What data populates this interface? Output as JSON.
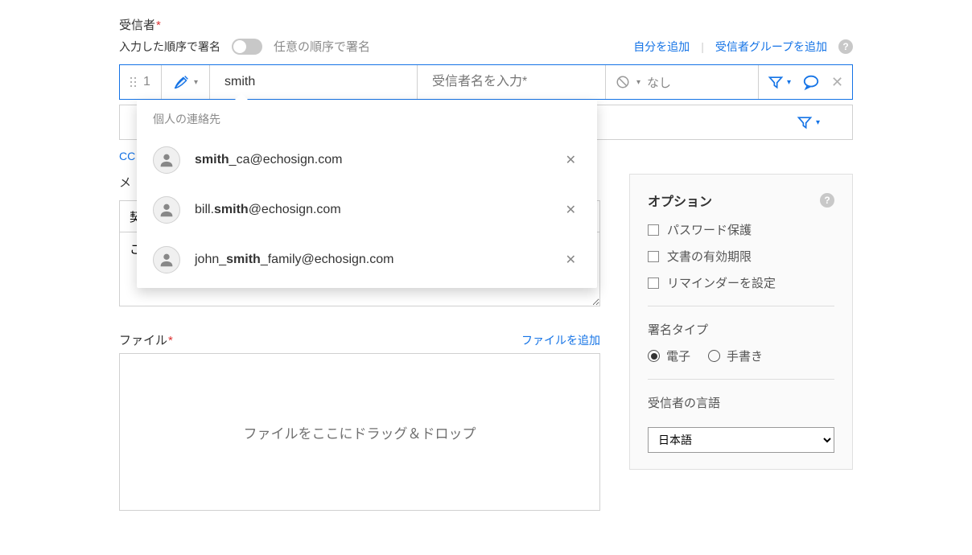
{
  "recipients": {
    "section_label": "受信者",
    "sign_order_label": "入力した順序で署名",
    "any_order_label": "任意の順序で署名",
    "add_self_link": "自分を追加",
    "add_group_link": "受信者グループを追加",
    "row": {
      "seq": "1",
      "email_value": "smith",
      "name_placeholder": "受信者名を入力*",
      "auth_text": "なし"
    },
    "autocomplete": {
      "header": "個人の連絡先",
      "items": [
        {
          "pre": "",
          "match": "smith",
          "post": "_ca@echosign.com"
        },
        {
          "pre": "bill.",
          "match": "smith",
          "post": "@echosign.com"
        },
        {
          "pre": "john_",
          "match": "smith",
          "post": "_family@echosign.com"
        }
      ]
    },
    "cc_label": "CC"
  },
  "message": {
    "section_label": "メ",
    "subject_value": "契",
    "body_value": "こ"
  },
  "files": {
    "section_label": "ファイル",
    "add_link": "ファイルを追加",
    "dropzone_text": "ファイルをここにドラッグ＆ドロップ"
  },
  "options": {
    "title": "オプション",
    "password": "パスワード保護",
    "expiry": "文書の有効期限",
    "reminder": "リマインダーを設定",
    "sig_type_title": "署名タイプ",
    "sig_electronic": "電子",
    "sig_handwritten": "手書き",
    "lang_title": "受信者の言語",
    "lang_value": "日本語"
  }
}
